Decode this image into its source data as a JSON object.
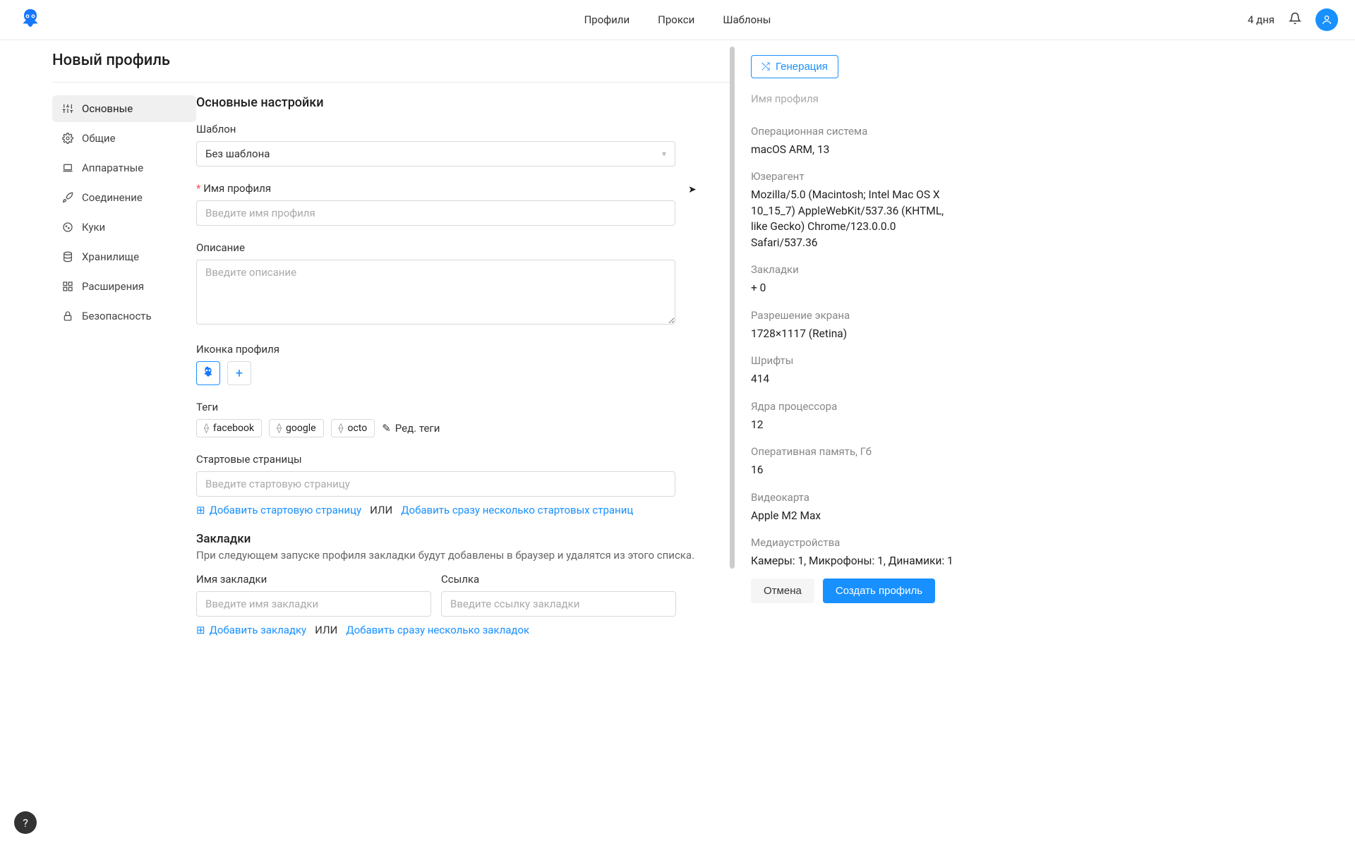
{
  "header": {
    "nav": {
      "profiles": "Профили",
      "proxies": "Прокси",
      "templates": "Шаблоны"
    },
    "days": "4 дня"
  },
  "page": {
    "title": "Новый профиль"
  },
  "sidebar": {
    "items": [
      {
        "label": "Основные"
      },
      {
        "label": "Общие"
      },
      {
        "label": "Аппаратные"
      },
      {
        "label": "Соединение"
      },
      {
        "label": "Куки"
      },
      {
        "label": "Хранилище"
      },
      {
        "label": "Расширения"
      },
      {
        "label": "Безопасность"
      }
    ]
  },
  "form": {
    "section_title": "Основные настройки",
    "template": {
      "label": "Шаблон",
      "value": "Без шаблона"
    },
    "name": {
      "label": "Имя профиля",
      "placeholder": "Введите имя профиля"
    },
    "description": {
      "label": "Описание",
      "placeholder": "Введите описание"
    },
    "icon": {
      "label": "Иконка профиля"
    },
    "tags": {
      "label": "Теги",
      "items": [
        "facebook",
        "google",
        "octo"
      ],
      "edit": "Ред. теги"
    },
    "start_pages": {
      "label": "Стартовые страницы",
      "placeholder": "Введите стартовую страницу",
      "add": "Добавить стартовую страницу",
      "or": "ИЛИ",
      "bulk": "Добавить сразу несколько стартовых страниц"
    },
    "bookmarks": {
      "title": "Закладки",
      "desc": "При следующем запуске профиля закладки будут добавлены в браузер и удалятся из этого списка.",
      "name_label": "Имя закладки",
      "name_placeholder": "Введите имя закладки",
      "link_label": "Ссылка",
      "link_placeholder": "Введите ссылку закладки",
      "add": "Добавить закладку",
      "or": "ИЛИ",
      "bulk": "Добавить сразу несколько закладок"
    }
  },
  "panel": {
    "generate": "Генерация",
    "name_placeholder": "Имя профиля",
    "os": {
      "label": "Операционная система",
      "value": "macOS ARM, 13"
    },
    "ua": {
      "label": "Юзерагент",
      "value": "Mozilla/5.0 (Macintosh; Intel Mac OS X 10_15_7) AppleWebKit/537.36 (KHTML, like Gecko) Chrome/123.0.0.0 Safari/537.36"
    },
    "bookmarks": {
      "label": "Закладки",
      "value": "+ 0"
    },
    "resolution": {
      "label": "Разрешение экрана",
      "value": "1728×1117 (Retina)"
    },
    "fonts": {
      "label": "Шрифты",
      "value": "414"
    },
    "cores": {
      "label": "Ядра процессора",
      "value": "12"
    },
    "ram": {
      "label": "Оперативная память, Гб",
      "value": "16"
    },
    "gpu": {
      "label": "Видеокарта",
      "value": "Apple M2 Max"
    },
    "media": {
      "label": "Медиаустройства",
      "value": "Камеры: 1, Микрофоны: 1, Динамики: 1"
    }
  },
  "actions": {
    "cancel": "Отмена",
    "create": "Создать профиль"
  }
}
